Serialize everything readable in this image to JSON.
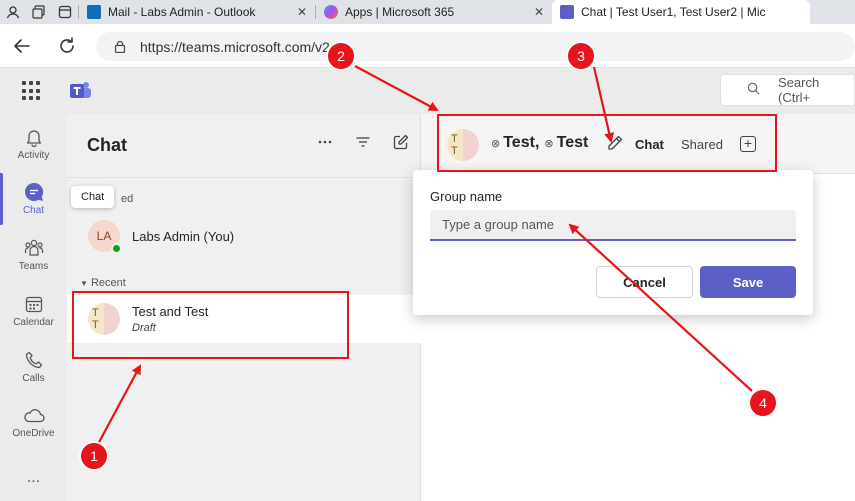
{
  "browser": {
    "tabs": [
      {
        "label": "",
        "kind": "icon"
      },
      {
        "label": "Mail - Labs Admin - Outlook",
        "close": "✕"
      },
      {
        "label": "Apps | Microsoft 365",
        "close": "✕"
      },
      {
        "label": "Chat | Test User1, Test User2 | Mic",
        "close": ""
      }
    ],
    "url": "https://teams.microsoft.com/v2"
  },
  "teams": {
    "search_placeholder": "Search (Ctrl+"
  },
  "rail": [
    {
      "label": "Activity",
      "icon": "bell-icon"
    },
    {
      "label": "Chat",
      "icon": "chat-icon"
    },
    {
      "label": "Teams",
      "icon": "teams-icon"
    },
    {
      "label": "Calendar",
      "icon": "calendar-icon"
    },
    {
      "label": "Calls",
      "icon": "phone-icon"
    },
    {
      "label": "OneDrive",
      "icon": "cloud-icon"
    },
    {
      "label": "...",
      "icon": "more-icon"
    }
  ],
  "chatlist": {
    "title": "Chat",
    "tooltip": "Chat",
    "pinned_label": "ed",
    "recent_label": "Recent",
    "pinned": {
      "initials": "LA",
      "name": "Labs Admin (You)"
    },
    "recent": [
      {
        "initials": "T T",
        "name": "Test and Test",
        "sub": "Draft"
      }
    ]
  },
  "header": {
    "initials": "T T",
    "name1": "Test",
    "separator": ",",
    "name2": "Test",
    "tabs": [
      "Chat",
      "Shared"
    ]
  },
  "popup": {
    "label": "Group name",
    "placeholder": "Type a group name",
    "cancel": "Cancel",
    "save": "Save"
  },
  "annotations": [
    "1",
    "2",
    "3",
    "4"
  ],
  "colors": {
    "accent": "#5b5fc7",
    "annotation": "#e8141b"
  }
}
